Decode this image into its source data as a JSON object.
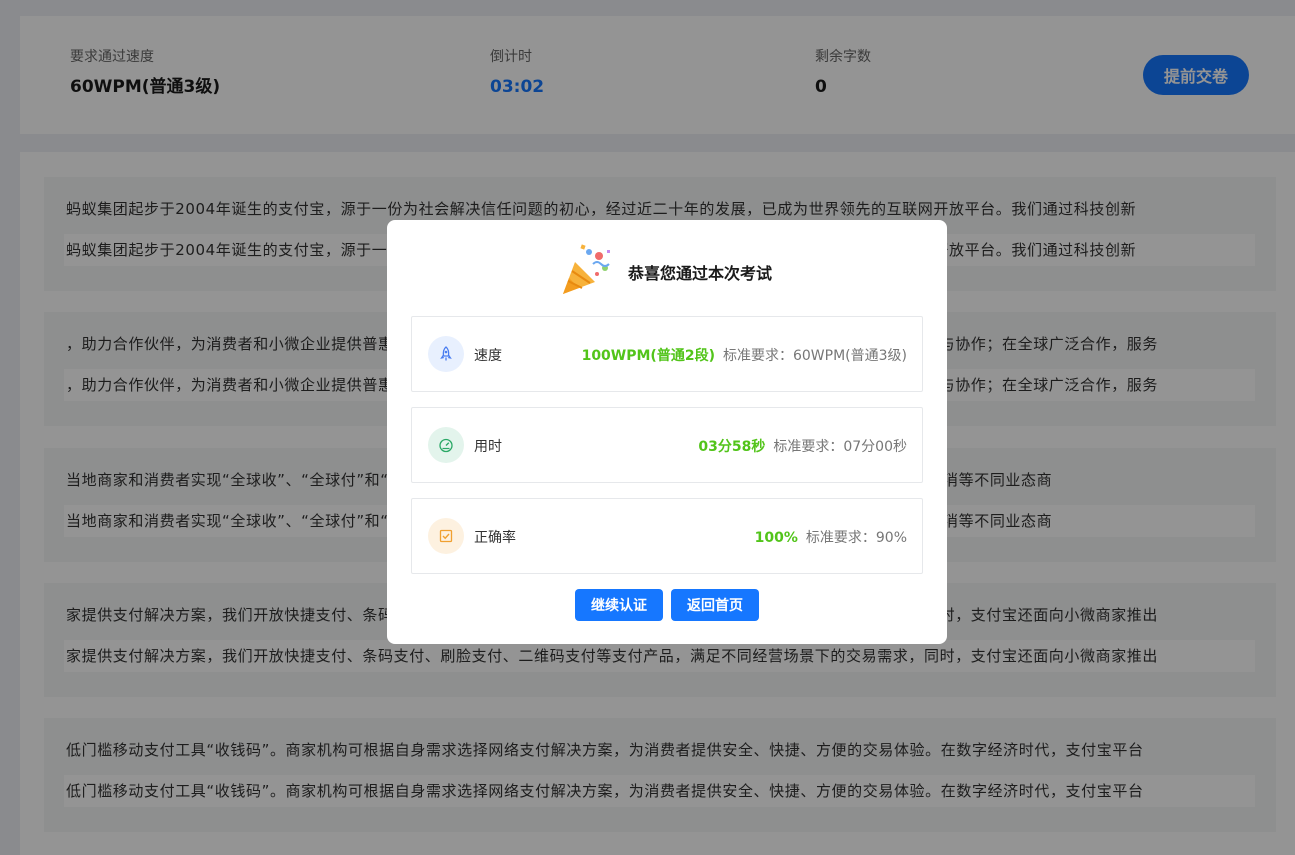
{
  "header": {
    "speed": {
      "label": "要求通过速度",
      "value": "60WPM(普通3级)"
    },
    "countdown": {
      "label": "倒计时",
      "value": "03:02"
    },
    "remaining": {
      "label": "剩余字数",
      "value": "0"
    },
    "submit_label": "提前交卷"
  },
  "paragraphs": [
    {
      "source": "蚂蚁集团起步于2004年诞生的支付宝，源于一份为社会解决信任问题的初心，经过近二十年的发展，已成为世界领先的互联网开放平台。我们通过科技创新",
      "typed": "蚂蚁集团起步于2004年诞生的支付宝，源于一份为社会解决信任问题的初心，经过近二十年的发展，已成为世界领先的互联网开放平台。我们通过科技创新"
    },
    {
      "source": "，助力合作伙伴，为消费者和小微企业提供普惠便捷的数字生活及数字金融服务；持续开放产品与技术，助力企业的数字化升级与协作；在全球广泛合作，服务",
      "typed": "，助力合作伙伴，为消费者和小微企业提供普惠便捷的数字生活及数字金融服务；持续开放产品与技术，助力企业的数字化升级与协作；在全球广泛合作，服务"
    },
    {
      "source": "当地商家和消费者实现“全球收”、“全球付”和“全球汇”。支付宝与全球合作伙伴一起，为包括中国在内的全球的餐饮、零售、快消等不同业态商",
      "typed": "当地商家和消费者实现“全球收”、“全球付”和“全球汇”。支付宝与全球合作伙伴一起，为包括中国在内的全球的餐饮、零售、快消等不同业态商"
    },
    {
      "source": "家提供支付解决方案，我们开放快捷支付、条码支付、刷脸支付、二维码支付等支付产品，满足不同经营场景下的交易需求，同时，支付宝还面向小微商家推出",
      "typed": "家提供支付解决方案，我们开放快捷支付、条码支付、刷脸支付、二维码支付等支付产品，满足不同经营场景下的交易需求，同时，支付宝还面向小微商家推出"
    },
    {
      "source": "低门槛移动支付工具“收钱码”。商家机构可根据自身需求选择网络支付解决方案，为消费者提供安全、快捷、方便的交易体验。在数字经济时代，支付宝平台",
      "typed": "低门槛移动支付工具“收钱码”。商家机构可根据自身需求选择网络支付解决方案，为消费者提供安全、快捷、方便的交易体验。在数字经济时代，支付宝平台"
    }
  ],
  "modal": {
    "title": "恭喜您通过本次考试",
    "results": [
      {
        "label": "速度",
        "value": "100WPM(普通2段)",
        "standard": "标准要求：60WPM(普通3级)",
        "icon": "rocket-icon",
        "icon_bg": "#e8f0fe",
        "icon_color": "#4a7df0"
      },
      {
        "label": "用时",
        "value": "03分58秒",
        "standard": "标准要求：07分00秒",
        "icon": "gauge-icon",
        "icon_bg": "#e3f4ec",
        "icon_color": "#2aa866"
      },
      {
        "label": "正确率",
        "value": "100%",
        "standard": "标准要求：90%",
        "icon": "checkbox-icon",
        "icon_bg": "#fdf1e0",
        "icon_color": "#f0a030"
      }
    ],
    "continue_label": "继续认证",
    "home_label": "返回首页"
  },
  "colors": {
    "accent": "#1677ff",
    "success": "#52c41a"
  }
}
